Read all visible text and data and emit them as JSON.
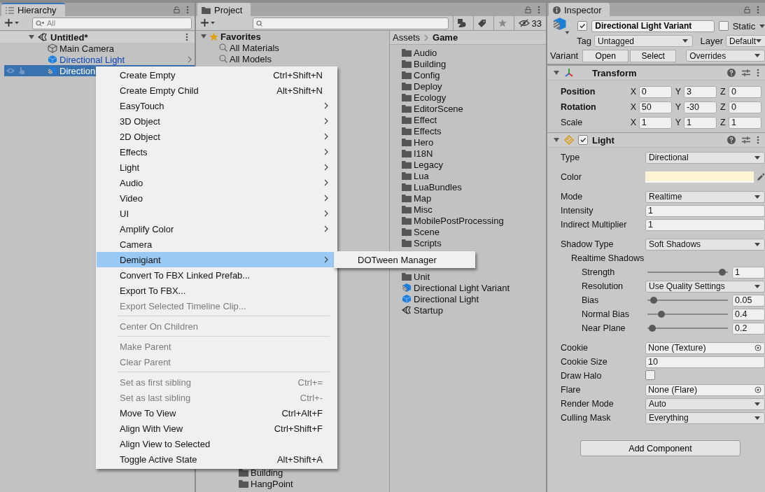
{
  "hierarchy": {
    "title": "Hierarchy",
    "focused": true,
    "search": {
      "placeholder": "All"
    },
    "scene": {
      "name": "Untitled*",
      "expanded": true
    },
    "items": [
      {
        "name": "Main Camera",
        "kind": "object",
        "selected": false,
        "has_children": false
      },
      {
        "name": "Directional Light",
        "kind": "prefab",
        "selected": false,
        "has_children": true
      },
      {
        "name": "Direction",
        "kind": "variant",
        "selected": true,
        "has_children": false
      }
    ]
  },
  "project": {
    "title": "Project",
    "focused": false,
    "hidden_count": "33",
    "favorites": {
      "label": "Favorites",
      "expanded": true,
      "items": [
        "All Materials",
        "All Models"
      ]
    },
    "tree_below_menu": [
      "Building",
      "HangPoint"
    ],
    "breadcrumb": [
      "Assets",
      "Game"
    ],
    "assets": [
      {
        "name": "Audio",
        "kind": "folder"
      },
      {
        "name": "Building",
        "kind": "folder"
      },
      {
        "name": "Config",
        "kind": "folder"
      },
      {
        "name": "Deploy",
        "kind": "folder"
      },
      {
        "name": "Ecology",
        "kind": "folder"
      },
      {
        "name": "EditorScene",
        "kind": "folder"
      },
      {
        "name": "Effect",
        "kind": "folder"
      },
      {
        "name": "Effects",
        "kind": "folder"
      },
      {
        "name": "Hero",
        "kind": "folder"
      },
      {
        "name": "I18N",
        "kind": "folder"
      },
      {
        "name": "Legacy",
        "kind": "folder"
      },
      {
        "name": "Lua",
        "kind": "folder"
      },
      {
        "name": "LuaBundles",
        "kind": "folder"
      },
      {
        "name": "Map",
        "kind": "folder"
      },
      {
        "name": "Misc",
        "kind": "folder"
      },
      {
        "name": "MobilePostProcessing",
        "kind": "folder"
      },
      {
        "name": "Scene",
        "kind": "folder"
      },
      {
        "name": "Scripts",
        "kind": "folder"
      }
    ],
    "assets_below_submenu": [
      {
        "name": "Unit",
        "kind": "folder"
      },
      {
        "name": "Directional Light Variant",
        "kind": "variant"
      },
      {
        "name": "Directional Light",
        "kind": "prefab"
      },
      {
        "name": "Startup",
        "kind": "scene"
      }
    ]
  },
  "inspector": {
    "title": "Inspector",
    "focused": false,
    "object": {
      "active": true,
      "name": "Directional Light Variant",
      "static_label": "Static",
      "static": false
    },
    "tag": {
      "label": "Tag",
      "value": "Untagged"
    },
    "layer": {
      "label": "Layer",
      "value": "Default"
    },
    "variant": {
      "label": "Variant",
      "buttons": [
        "Open",
        "Select"
      ],
      "overrides": "Overrides"
    },
    "transform": {
      "title": "Transform",
      "expanded": true,
      "rows": [
        {
          "label": "Position",
          "overridden": true,
          "values": [
            {
              "axis": "X",
              "value": "0"
            },
            {
              "axis": "Y",
              "value": "3"
            },
            {
              "axis": "Z",
              "value": "0"
            }
          ]
        },
        {
          "label": "Rotation",
          "overridden": true,
          "values": [
            {
              "axis": "X",
              "value": "50"
            },
            {
              "axis": "Y",
              "value": "-30"
            },
            {
              "axis": "Z",
              "value": "0"
            }
          ]
        },
        {
          "label": "Scale",
          "overridden": false,
          "values": [
            {
              "axis": "X",
              "value": "1"
            },
            {
              "axis": "Y",
              "value": "1"
            },
            {
              "axis": "Z",
              "value": "1"
            }
          ]
        }
      ]
    },
    "light": {
      "title": "Light",
      "enabled": true,
      "expanded": true,
      "groups": [
        [
          {
            "kind": "dropdown",
            "label": "Type",
            "value": "Directional"
          }
        ],
        [
          {
            "kind": "color",
            "label": "Color",
            "color": "#fff4d6"
          }
        ],
        [
          {
            "kind": "dropdown",
            "label": "Mode",
            "value": "Realtime"
          },
          {
            "kind": "number",
            "label": "Intensity",
            "value": "1"
          },
          {
            "kind": "number",
            "label": "Indirect Multiplier",
            "value": "1"
          }
        ],
        [
          {
            "kind": "dropdown",
            "label": "Shadow Type",
            "value": "Soft Shadows",
            "children": [
              {
                "kind": "heading",
                "label": "Realtime Shadows",
                "children": [
                  {
                    "kind": "slider",
                    "label": "Strength",
                    "level": 0.97,
                    "value": "1"
                  },
                  {
                    "kind": "dropdown",
                    "label": "Resolution",
                    "value": "Use Quality Settings"
                  },
                  {
                    "kind": "slider",
                    "label": "Bias",
                    "level": 0.04,
                    "value": "0.05"
                  },
                  {
                    "kind": "slider",
                    "label": "Normal Bias",
                    "level": 0.14,
                    "value": "0.4"
                  },
                  {
                    "kind": "slider",
                    "label": "Near Plane",
                    "level": 0.02,
                    "value": "0.2"
                  }
                ]
              }
            ]
          }
        ],
        [
          {
            "kind": "object",
            "label": "Cookie",
            "value": "None (Texture)"
          },
          {
            "kind": "number",
            "label": "Cookie Size",
            "value": "10"
          },
          {
            "kind": "checkbox",
            "label": "Draw Halo",
            "checked": false
          },
          {
            "kind": "object",
            "label": "Flare",
            "value": "None (Flare)"
          },
          {
            "kind": "dropdown",
            "label": "Render Mode",
            "value": "Auto"
          },
          {
            "kind": "dropdown",
            "label": "Culling Mask",
            "value": "Everything"
          }
        ]
      ]
    },
    "add_component": "Add Component"
  },
  "context_menu": {
    "items": [
      {
        "kind": "item",
        "label": "Create Empty",
        "shortcut": "Ctrl+Shift+N",
        "submenu": false,
        "disabled": false,
        "selected": false
      },
      {
        "kind": "item",
        "label": "Create Empty Child",
        "shortcut": "Alt+Shift+N",
        "submenu": false,
        "disabled": false,
        "selected": false
      },
      {
        "kind": "item",
        "label": "EasyTouch",
        "submenu": true,
        "disabled": false,
        "selected": false
      },
      {
        "kind": "item",
        "label": "3D Object",
        "submenu": true,
        "disabled": false,
        "selected": false
      },
      {
        "kind": "item",
        "label": "2D Object",
        "submenu": true,
        "disabled": false,
        "selected": false
      },
      {
        "kind": "item",
        "label": "Effects",
        "submenu": true,
        "disabled": false,
        "selected": false
      },
      {
        "kind": "item",
        "label": "Light",
        "submenu": true,
        "disabled": false,
        "selected": false
      },
      {
        "kind": "item",
        "label": "Audio",
        "submenu": true,
        "disabled": false,
        "selected": false
      },
      {
        "kind": "item",
        "label": "Video",
        "submenu": true,
        "disabled": false,
        "selected": false
      },
      {
        "kind": "item",
        "label": "UI",
        "submenu": true,
        "disabled": false,
        "selected": false
      },
      {
        "kind": "item",
        "label": "Amplify Color",
        "submenu": true,
        "disabled": false,
        "selected": false
      },
      {
        "kind": "item",
        "label": "Camera",
        "submenu": false,
        "disabled": false,
        "selected": false
      },
      {
        "kind": "item",
        "label": "Demigiant",
        "submenu": true,
        "disabled": false,
        "selected": true
      },
      {
        "kind": "item",
        "label": "Convert To FBX Linked Prefab...",
        "submenu": false,
        "disabled": false,
        "selected": false
      },
      {
        "kind": "item",
        "label": "Export To FBX...",
        "submenu": false,
        "disabled": false,
        "selected": false
      },
      {
        "kind": "item",
        "label": "Export Selected Timeline Clip...",
        "submenu": false,
        "disabled": true,
        "selected": false
      },
      {
        "kind": "separator"
      },
      {
        "kind": "item",
        "label": "Center On Children",
        "submenu": false,
        "disabled": true,
        "selected": false
      },
      {
        "kind": "separator"
      },
      {
        "kind": "item",
        "label": "Make Parent",
        "submenu": false,
        "disabled": true,
        "selected": false
      },
      {
        "kind": "item",
        "label": "Clear Parent",
        "submenu": false,
        "disabled": true,
        "selected": false
      },
      {
        "kind": "separator"
      },
      {
        "kind": "item",
        "label": "Set as first sibling",
        "shortcut": "Ctrl+=",
        "submenu": false,
        "disabled": true,
        "selected": false
      },
      {
        "kind": "item",
        "label": "Set as last sibling",
        "shortcut": "Ctrl+-",
        "submenu": false,
        "disabled": true,
        "selected": false
      },
      {
        "kind": "item",
        "label": "Move To View",
        "shortcut": "Ctrl+Alt+F",
        "submenu": false,
        "disabled": false,
        "selected": false
      },
      {
        "kind": "item",
        "label": "Align With View",
        "shortcut": "Ctrl+Shift+F",
        "submenu": false,
        "disabled": false,
        "selected": false
      },
      {
        "kind": "item",
        "label": "Align View to Selected",
        "submenu": false,
        "disabled": false,
        "selected": false
      },
      {
        "kind": "item",
        "label": "Toggle Active State",
        "shortcut": "Alt+Shift+A",
        "submenu": false,
        "disabled": false,
        "selected": false
      }
    ]
  },
  "submenu": {
    "items": [
      {
        "label": "DOTween Manager"
      }
    ]
  }
}
